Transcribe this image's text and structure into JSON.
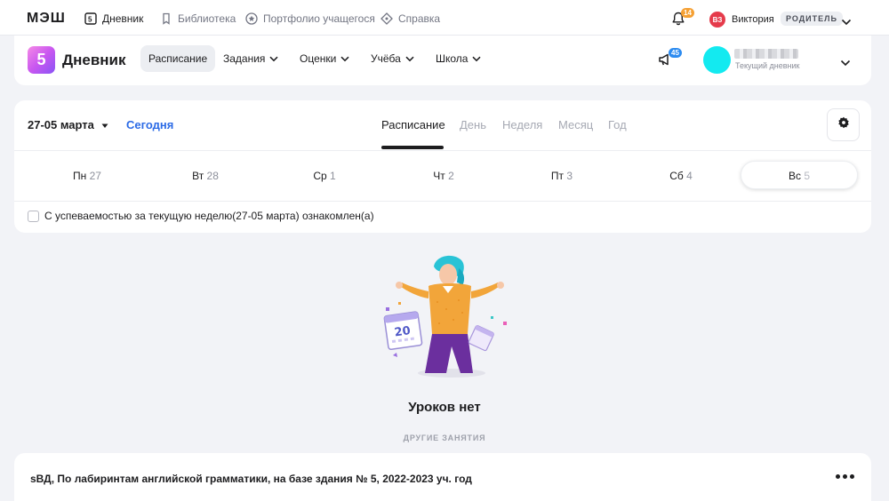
{
  "topbar": {
    "logo": "МЭШ",
    "nav": [
      {
        "label": "Дневник",
        "icon": "diary-5-icon",
        "active": true
      },
      {
        "label": "Библиотека",
        "icon": "bookmark-icon",
        "active": false
      },
      {
        "label": "Портфолио учащегося",
        "icon": "star-circle-icon",
        "active": false
      },
      {
        "label": "Справка",
        "icon": "diamond-help-icon",
        "active": false
      }
    ],
    "notifications_count": "14",
    "user_initials": "ВЗ",
    "user_name": "Виктория",
    "role": "РОДИТЕЛЬ"
  },
  "header": {
    "app_icon_text": "5",
    "app_title": "Дневник",
    "tabs": [
      {
        "label": "Расписание",
        "active": true,
        "dropdown": false
      },
      {
        "label": "Задания",
        "active": false,
        "dropdown": true
      },
      {
        "label": "Оценки",
        "active": false,
        "dropdown": true
      },
      {
        "label": "Учёба",
        "active": false,
        "dropdown": true
      },
      {
        "label": "Школа",
        "active": false,
        "dropdown": true
      }
    ],
    "announcements_count": "45",
    "child_subtitle": "Текущий дневник"
  },
  "schedule": {
    "date_range": "27-05 марта",
    "today_label": "Сегодня",
    "views": [
      {
        "label": "Расписание",
        "active": true
      },
      {
        "label": "День",
        "active": false
      },
      {
        "label": "Неделя",
        "active": false
      },
      {
        "label": "Месяц",
        "active": false
      },
      {
        "label": "Год",
        "active": false
      }
    ],
    "days": [
      {
        "name": "Пн",
        "num": "27"
      },
      {
        "name": "Вт",
        "num": "28"
      },
      {
        "name": "Ср",
        "num": "1"
      },
      {
        "name": "Чт",
        "num": "2"
      },
      {
        "name": "Пт",
        "num": "3"
      },
      {
        "name": "Сб",
        "num": "4"
      },
      {
        "name": "Вс",
        "num": "5"
      }
    ],
    "selected_day": "Вс",
    "ack_text": "С успеваемостью за текущую неделю(27-05 марта) ознакомлен(а)"
  },
  "empty_state": {
    "title": "Уроков нет",
    "calendar_number": "20",
    "other_label": "ДРУГИЕ ЗАНЯТИЯ"
  },
  "other_activity": {
    "title": "sВД, По лабиринтам английской грамматики, на базе здания № 5, 2022-2023 уч. год"
  },
  "colors": {
    "accent_blue": "#2c6be6",
    "badge_orange": "#f5a033",
    "badge_blue": "#2c8bf0",
    "avatar_red": "#e53b4b",
    "child_avatar_cyan": "#13eaf0"
  }
}
